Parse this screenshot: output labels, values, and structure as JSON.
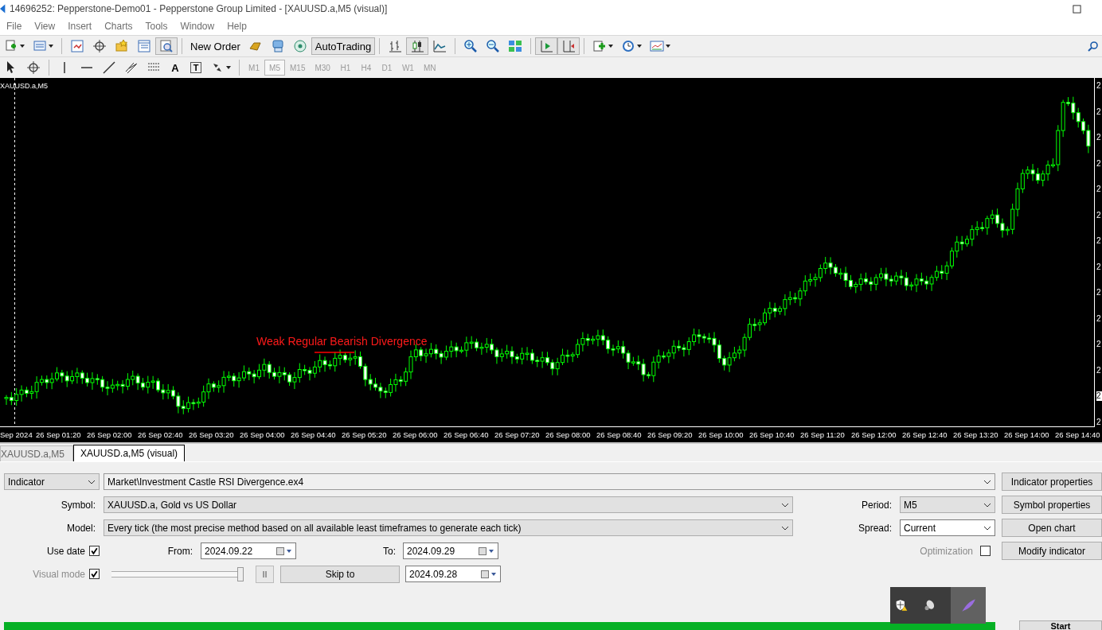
{
  "window": {
    "title": "14696252: Pepperstone-Demo01 - Pepperstone Group Limited - [XAUUSD.a,M5 (visual)]"
  },
  "menu": [
    "File",
    "View",
    "Insert",
    "Charts",
    "Tools",
    "Window",
    "Help"
  ],
  "toolbar": [
    {
      "kind": "icon",
      "pressed": false,
      "menu": true
    },
    {
      "kind": "icon",
      "pressed": false,
      "menu": true
    },
    {
      "kind": "separator"
    },
    {
      "kind": "icon",
      "pressed": false,
      "menu": false
    },
    {
      "kind": "icon",
      "pressed": false,
      "menu": false
    },
    {
      "kind": "icon",
      "pressed": false,
      "menu": false
    },
    {
      "kind": "icon",
      "pressed": false,
      "menu": false
    },
    {
      "kind": "icon",
      "pressed": true,
      "menu": false
    },
    {
      "kind": "separator"
    },
    {
      "kind": "button",
      "label": "New Order",
      "pressed": false
    },
    {
      "kind": "icon",
      "pressed": false,
      "menu": false
    },
    {
      "kind": "icon",
      "pressed": false,
      "menu": false
    },
    {
      "kind": "icon",
      "pressed": false,
      "menu": false
    },
    {
      "kind": "button",
      "label": "AutoTrading",
      "pressed": true
    },
    {
      "kind": "separator"
    },
    {
      "kind": "icon",
      "pressed": false,
      "menu": false
    },
    {
      "kind": "icon",
      "pressed": true,
      "menu": false
    },
    {
      "kind": "icon",
      "pressed": false,
      "menu": false
    },
    {
      "kind": "separator"
    },
    {
      "kind": "icon",
      "pressed": false,
      "menu": false
    },
    {
      "kind": "icon",
      "pressed": false,
      "menu": false
    },
    {
      "kind": "icon",
      "pressed": false,
      "menu": false
    },
    {
      "kind": "separator"
    },
    {
      "kind": "icon",
      "pressed": true,
      "menu": false
    },
    {
      "kind": "icon",
      "pressed": true,
      "menu": false
    },
    {
      "kind": "separator"
    },
    {
      "kind": "icon",
      "pressed": false,
      "menu": true
    },
    {
      "kind": "icon",
      "pressed": false,
      "menu": true
    },
    {
      "kind": "icon",
      "pressed": false,
      "menu": true
    }
  ],
  "drawing_tools": [
    {
      "kind": "icon",
      "menu": false
    },
    {
      "kind": "icon",
      "menu": false
    },
    {
      "kind": "separator"
    },
    {
      "kind": "icon",
      "menu": false
    },
    {
      "kind": "icon",
      "menu": false
    },
    {
      "kind": "icon",
      "menu": false
    },
    {
      "kind": "icon",
      "menu": false
    },
    {
      "kind": "icon",
      "menu": false
    },
    {
      "kind": "text",
      "label": "A"
    },
    {
      "kind": "boxed-text",
      "label": "T"
    },
    {
      "kind": "icon",
      "menu": true
    },
    {
      "kind": "separator"
    }
  ],
  "timeframes": [
    {
      "label": "M1",
      "selected": false
    },
    {
      "label": "M5",
      "selected": true
    },
    {
      "label": "M15",
      "selected": false
    },
    {
      "label": "M30",
      "selected": false
    },
    {
      "label": "H1",
      "selected": false
    },
    {
      "label": "H4",
      "selected": false
    },
    {
      "label": "D1",
      "selected": false
    },
    {
      "label": "W1",
      "selected": false
    },
    {
      "label": "MN",
      "selected": false
    }
  ],
  "chart": {
    "symbol_label": "XAUUSD.a,M5",
    "annotation": "Weak Regular Bearish Divergence",
    "price_labels": [
      {
        "text": "2",
        "current": false
      },
      {
        "text": "2",
        "current": false
      },
      {
        "text": "2",
        "current": false
      },
      {
        "text": "2",
        "current": false
      },
      {
        "text": "2",
        "current": false
      },
      {
        "text": "2",
        "current": false
      },
      {
        "text": "2",
        "current": false
      },
      {
        "text": "2",
        "current": false
      },
      {
        "text": "2",
        "current": false
      },
      {
        "text": "2",
        "current": false
      },
      {
        "text": "2",
        "current": false
      },
      {
        "text": "2",
        "current": false
      },
      {
        "text": "2",
        "current": true
      },
      {
        "text": "2",
        "current": false
      }
    ],
    "time_labels": [
      "Sep 2024",
      "26 Sep 01:20",
      "26 Sep 02:00",
      "26 Sep 02:40",
      "26 Sep 03:20",
      "26 Sep 04:00",
      "26 Sep 04:40",
      "26 Sep 05:20",
      "26 Sep 06:00",
      "26 Sep 06:40",
      "26 Sep 07:20",
      "26 Sep 08:00",
      "26 Sep 08:40",
      "26 Sep 09:20",
      "26 Sep 10:00",
      "26 Sep 10:40",
      "26 Sep 11:20",
      "26 Sep 12:00",
      "26 Sep 12:40",
      "26 Sep 13:20",
      "26 Sep 14:00",
      "26 Sep 14:40"
    ]
  },
  "chart_tabs": [
    {
      "label": "XAUUSD.a,M5",
      "selected": false
    },
    {
      "label": "XAUUSD.a,M5 (visual)",
      "selected": true
    }
  ],
  "tester": {
    "type_select": "Indicator",
    "expert_file": "Market\\Investment Castle RSI Divergence.ex4",
    "symbol_label": "Symbol:",
    "symbol": "XAUUSD.a, Gold vs US Dollar",
    "model_label": "Model:",
    "model": "Every tick (the most precise method based on all available least timeframes to generate each tick)",
    "period_label": "Period:",
    "period": "M5",
    "spread_label": "Spread:",
    "spread": "Current",
    "use_date": {
      "label": "Use date",
      "checked": true,
      "dimmed": false
    },
    "from_label": "From:",
    "from": "2024.09.22",
    "to_label": "To:",
    "to": "2024.09.29",
    "optimization": {
      "label": "Optimization",
      "checked": false,
      "dimmed": true
    },
    "visual_mode": {
      "label": "Visual mode",
      "checked": true,
      "dimmed": true
    },
    "speed": {
      "level": 1
    },
    "pause_label": "II",
    "skip_button": "Skip to",
    "skip_date": "2024.09.28",
    "buttons": [
      "Indicator properties",
      "Symbol properties",
      "Open chart",
      "Modify indicator"
    ],
    "progress": {
      "level": 1
    },
    "start_button": "Start"
  }
}
